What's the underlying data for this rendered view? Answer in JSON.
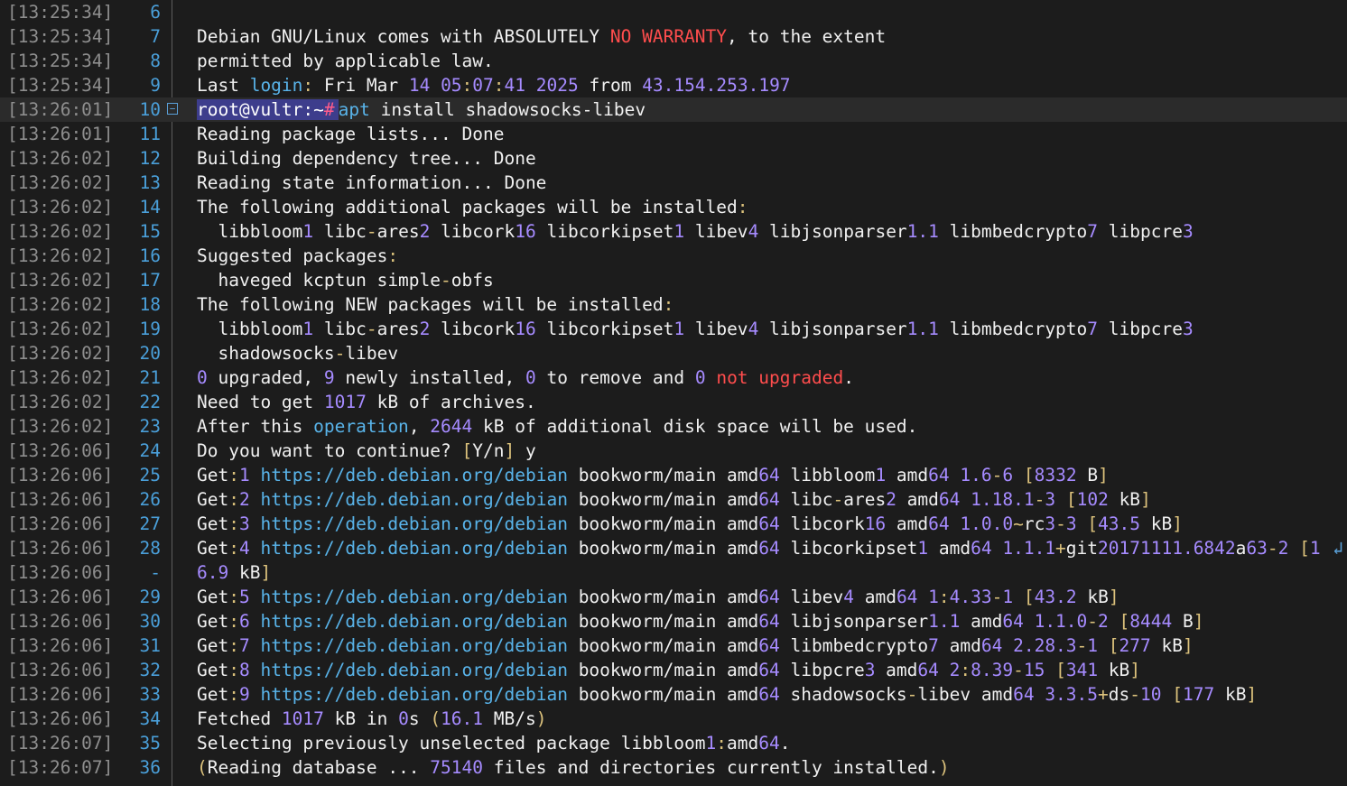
{
  "terminal": {
    "rows": [
      {
        "time": "[13:25:34]",
        "num": "6",
        "text": ""
      },
      {
        "time": "[13:25:34]",
        "num": "7",
        "text": "Debian GNU/Linux comes with ABSOLUTELY NO WARRANTY, to the extent"
      },
      {
        "time": "[13:25:34]",
        "num": "8",
        "text": "permitted by applicable law."
      },
      {
        "time": "[13:25:34]",
        "num": "9",
        "text": "Last login: Fri Mar 14 05:07:41 2025 from 43.154.253.197"
      },
      {
        "time": "[13:26:01]",
        "num": "10",
        "text": "root@vultr:~# apt install shadowsocks-libev"
      },
      {
        "time": "[13:26:01]",
        "num": "11",
        "text": "Reading package lists... Done"
      },
      {
        "time": "[13:26:02]",
        "num": "12",
        "text": "Building dependency tree... Done"
      },
      {
        "time": "[13:26:02]",
        "num": "13",
        "text": "Reading state information... Done"
      },
      {
        "time": "[13:26:02]",
        "num": "14",
        "text": "The following additional packages will be installed:"
      },
      {
        "time": "[13:26:02]",
        "num": "15",
        "text": "  libbloom1 libc-ares2 libcork16 libcorkipset1 libev4 libjsonparser1.1 libmbedcrypto7 libpcre3"
      },
      {
        "time": "[13:26:02]",
        "num": "16",
        "text": "Suggested packages:"
      },
      {
        "time": "[13:26:02]",
        "num": "17",
        "text": "  haveged kcptun simple-obfs"
      },
      {
        "time": "[13:26:02]",
        "num": "18",
        "text": "The following NEW packages will be installed:"
      },
      {
        "time": "[13:26:02]",
        "num": "19",
        "text": "  libbloom1 libc-ares2 libcork16 libcorkipset1 libev4 libjsonparser1.1 libmbedcrypto7 libpcre3"
      },
      {
        "time": "[13:26:02]",
        "num": "20",
        "text": "  shadowsocks-libev"
      },
      {
        "time": "[13:26:02]",
        "num": "21",
        "text": "0 upgraded, 9 newly installed, 0 to remove and 0 not upgraded."
      },
      {
        "time": "[13:26:02]",
        "num": "22",
        "text": "Need to get 1017 kB of archives."
      },
      {
        "time": "[13:26:02]",
        "num": "23",
        "text": "After this operation, 2644 kB of additional disk space will be used."
      },
      {
        "time": "[13:26:06]",
        "num": "24",
        "text": "Do you want to continue? [Y/n] y"
      },
      {
        "time": "[13:26:06]",
        "num": "25",
        "text": "Get:1 https://deb.debian.org/debian bookworm/main amd64 libbloom1 amd64 1.6-6 [8332 B]"
      },
      {
        "time": "[13:26:06]",
        "num": "26",
        "text": "Get:2 https://deb.debian.org/debian bookworm/main amd64 libc-ares2 amd64 1.18.1-3 [102 kB]"
      },
      {
        "time": "[13:26:06]",
        "num": "27",
        "text": "Get:3 https://deb.debian.org/debian bookworm/main amd64 libcork16 amd64 1.0.0~rc3-3 [43.5 kB]"
      },
      {
        "time": "[13:26:06]",
        "num": "28",
        "text": "Get:4 https://deb.debian.org/debian bookworm/main amd64 libcorkipset1 amd64 1.1.1+git20171111.6842a63-2 [1"
      },
      {
        "time": "[13:26:06]",
        "num": "-",
        "text": "6.9 kB]"
      },
      {
        "time": "[13:26:06]",
        "num": "29",
        "text": "Get:5 https://deb.debian.org/debian bookworm/main amd64 libev4 amd64 1:4.33-1 [43.2 kB]"
      },
      {
        "time": "[13:26:06]",
        "num": "30",
        "text": "Get:6 https://deb.debian.org/debian bookworm/main amd64 libjsonparser1.1 amd64 1.1.0-2 [8444 B]"
      },
      {
        "time": "[13:26:06]",
        "num": "31",
        "text": "Get:7 https://deb.debian.org/debian bookworm/main amd64 libmbedcrypto7 amd64 2.28.3-1 [277 kB]"
      },
      {
        "time": "[13:26:06]",
        "num": "32",
        "text": "Get:8 https://deb.debian.org/debian bookworm/main amd64 libpcre3 amd64 2:8.39-15 [341 kB]"
      },
      {
        "time": "[13:26:06]",
        "num": "33",
        "text": "Get:9 https://deb.debian.org/debian bookworm/main amd64 shadowsocks-libev amd64 3.3.5+ds-10 [177 kB]"
      },
      {
        "time": "[13:26:06]",
        "num": "34",
        "text": "Fetched 1017 kB in 0s (16.1 MB/s)"
      },
      {
        "time": "[13:26:07]",
        "num": "35",
        "text": "Selecting previously unselected package libbloom1:amd64."
      },
      {
        "time": "[13:26:07]",
        "num": "36",
        "text": "(Reading database ... 75140 files and directories currently installed.)"
      }
    ],
    "prompt": "root@vultr:~#",
    "wrap_indicator": "↲",
    "colors": {
      "background": "#1c1c1c",
      "text": "#f0f0f0",
      "timestamp": "#8e8e8e",
      "line_number": "#4a9fd9",
      "error": "#ff4d4d",
      "url": "#59b4ea",
      "string": "#b7e35a",
      "number": "#a68bff",
      "punctuation": "#dcc27c",
      "prompt_bg": "#3d3d8c"
    }
  }
}
